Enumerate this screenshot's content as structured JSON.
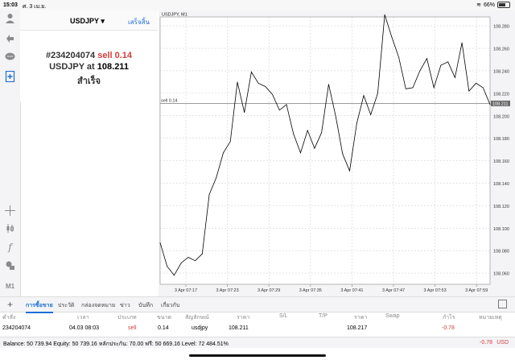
{
  "status_bar": {
    "time": "15:03",
    "date": "ศ. 3 เม.ย.",
    "battery": "66%",
    "battery_level": 0.66
  },
  "sidebar": {
    "icons": [
      "user-icon",
      "trade-icon",
      "chat-icon",
      "new-order-icon",
      "crosshair-icon",
      "candles-icon",
      "indicator-icon",
      "objects-icon",
      "timeframe-icon"
    ],
    "timeframe_label": "M1"
  },
  "order_panel": {
    "symbol": "USDJPY",
    "done_label": "เสร็จสิ้น",
    "order_id": "#234204074",
    "side_text": "sell 0.14",
    "at_text": "USDJPY at",
    "price": "108.211",
    "status": "สำเร็จ"
  },
  "chart_data": {
    "type": "line",
    "title": "USDJPY, M1",
    "x_labels": [
      "3 Apr 07:17",
      "3 Apr 07:23",
      "3 Apr 07:29",
      "3 Apr 07:35",
      "3 Apr 07:41",
      "3 Apr 07:47",
      "3 Apr 07:53",
      "3 Apr 07:59"
    ],
    "y_ticks": [
      "108.060",
      "108.080",
      "108.100",
      "108.120",
      "108.140",
      "108.160",
      "108.180",
      "108.200",
      "108.220",
      "108.240",
      "108.260",
      "108.280"
    ],
    "ylim": [
      108.05,
      108.288
    ],
    "values": [
      108.087,
      108.066,
      108.058,
      108.069,
      108.074,
      108.071,
      108.077,
      108.13,
      108.145,
      108.167,
      108.177,
      108.23,
      108.203,
      108.239,
      108.229,
      108.226,
      108.219,
      108.205,
      108.21,
      108.184,
      108.167,
      108.187,
      108.171,
      108.185,
      108.228,
      108.2,
      108.166,
      108.151,
      108.193,
      108.218,
      108.201,
      108.22,
      108.29,
      108.27,
      108.252,
      108.224,
      108.225,
      108.24,
      108.251,
      108.225,
      108.245,
      108.248,
      108.234,
      108.265,
      108.222,
      108.229,
      108.225,
      108.21
    ],
    "order_line": {
      "label": "sell 0.14",
      "value": 108.211,
      "price_label": "108.211"
    },
    "grid": true,
    "colors": {
      "line": "#000000",
      "grid": "#c9c9cf",
      "axis": "#888888",
      "price_tag": "#6a6a6a"
    }
  },
  "tabs": {
    "items": [
      {
        "label": "การซื้อขาย",
        "active": true
      },
      {
        "label": "ประวัติ",
        "active": false
      },
      {
        "label": "กล่องจดหมาย",
        "active": false
      },
      {
        "label": "ข่าว",
        "active": false
      },
      {
        "label": "บันทึก",
        "active": false
      },
      {
        "label": "เกี่ยวกับ",
        "active": false
      }
    ]
  },
  "table": {
    "headers": [
      "คำสั่ง",
      "เวลา",
      "ประเภท",
      "ขนาด",
      "สัญลักษณ์",
      "ราคา",
      "S/L",
      "T/P",
      "ราคา",
      "Swap",
      "กำไร",
      "หมายเหตุ"
    ],
    "rows": [
      {
        "order": "234204074",
        "time": "04.03 08:03",
        "type": "sell",
        "size": "0.14",
        "symbol": "usdjpy",
        "price": "108.211",
        "sl": "",
        "tp": "",
        "current_price": "108.217",
        "swap": "",
        "profit": "-0.78",
        "comment": ""
      }
    ]
  },
  "balance": {
    "text": "Balance: 50 739.94 Equity: 50 739.16 หลักประกัน: 70.00 ฟรี: 50 669.16 Level: 72 484.51%",
    "profit": "-0.78",
    "currency": "USD"
  },
  "colors": {
    "accent": "#1e6fd9",
    "sell": "#d23c3c"
  }
}
